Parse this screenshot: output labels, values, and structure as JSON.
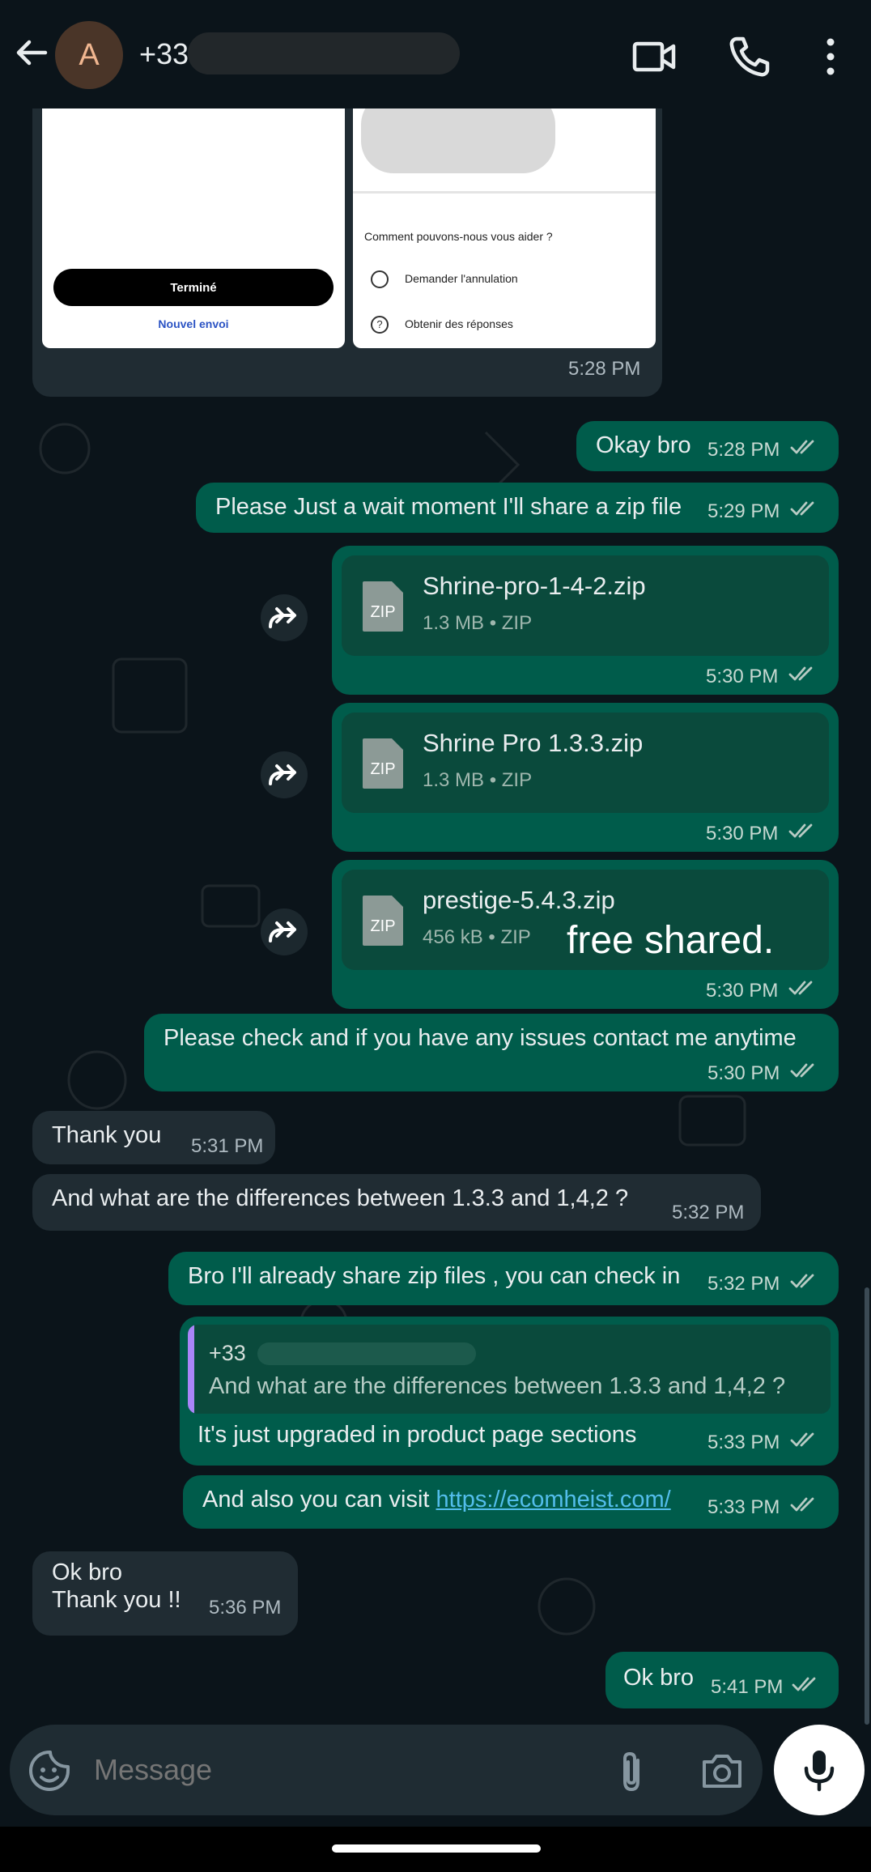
{
  "header": {
    "contact_initial": "A",
    "contact_number": "+33",
    "icons": {
      "back": "back-arrow-icon",
      "video": "video-call-icon",
      "call": "phone-call-icon",
      "menu": "more-vert-icon"
    }
  },
  "media_message": {
    "left_card": {
      "done_button": "Terminé",
      "link": "Nouvel envoi"
    },
    "right_card": {
      "question": "Comment pouvons-nous vous aider ?",
      "options": [
        "Demander l'annulation",
        "Obtenir des réponses"
      ]
    },
    "time": "5:28 PM"
  },
  "messages": [
    {
      "id": "m1",
      "text": "Okay bro",
      "time": "5:28 PM"
    },
    {
      "id": "m2",
      "text": "Please Just a wait moment I'll share a zip file",
      "time": "5:29 PM"
    },
    {
      "id": "m3",
      "file": "Shrine-pro-1-4-2.zip",
      "meta": "1.3 MB • ZIP",
      "time": "5:30 PM"
    },
    {
      "id": "m4",
      "file": "Shrine Pro 1.3.3.zip",
      "meta": "1.3 MB • ZIP",
      "time": "5:30 PM"
    },
    {
      "id": "m5",
      "file": "prestige-5.4.3.zip",
      "meta": "456 kB • ZIP",
      "overlay": "free shared.",
      "time": "5:30 PM"
    },
    {
      "id": "m6",
      "text": "Please check and if you have any issues contact me anytime",
      "time": "5:30 PM"
    },
    {
      "id": "m7",
      "text": "Thank you",
      "time": "5:31 PM"
    },
    {
      "id": "m8",
      "text": "And what are the differences between 1.3.3 and 1,4,2 ?",
      "time": "5:32 PM"
    },
    {
      "id": "m9",
      "text": "Bro I'll already share zip files , you can check in",
      "time": "5:32 PM"
    },
    {
      "id": "m10",
      "reply_sender": "+33",
      "reply_text": "And what are the differences between 1.3.3 and 1,4,2 ?",
      "text": "It's just upgraded in product page sections",
      "time": "5:33 PM"
    },
    {
      "id": "m11",
      "text": "And also you can visit ",
      "link": "https://ecomheist.com/",
      "time": "5:33 PM"
    },
    {
      "id": "m12",
      "line1": "Ok bro",
      "line2": "Thank you !!",
      "time": "5:36 PM"
    },
    {
      "id": "m13",
      "text": "Ok bro",
      "time": "5:41 PM"
    }
  ],
  "input": {
    "placeholder": "Message"
  },
  "colors": {
    "incoming": "#202c33",
    "outgoing": "#005c4b",
    "link": "#53bdeb",
    "background": "#0b141a"
  }
}
